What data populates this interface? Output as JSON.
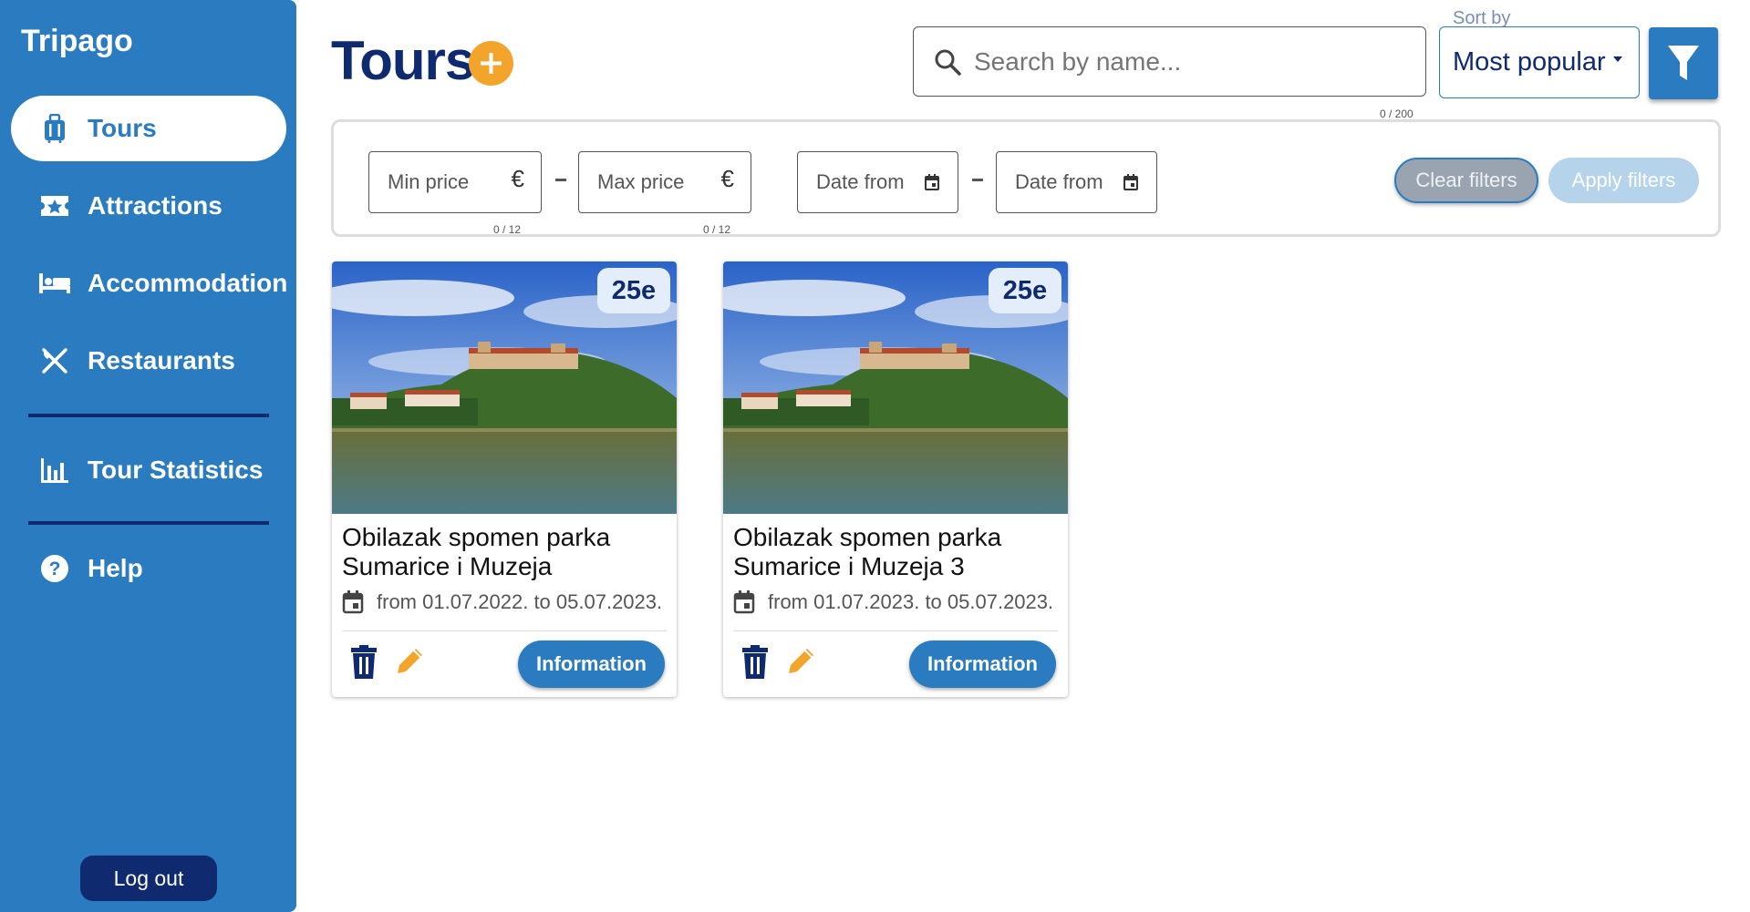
{
  "app": {
    "brand": "Tripago"
  },
  "sidebar": {
    "items": [
      {
        "label": "Tours",
        "icon": "suitcase-icon",
        "active": true
      },
      {
        "label": "Attractions",
        "icon": "ticket-star-icon",
        "active": false
      },
      {
        "label": "Accommodation",
        "icon": "bed-icon",
        "active": false
      },
      {
        "label": "Restaurants",
        "icon": "fork-knife-icon",
        "active": false
      },
      {
        "label": "Tour Statistics",
        "icon": "bar-chart-icon",
        "active": false
      },
      {
        "label": "Help",
        "icon": "help-icon",
        "active": false
      }
    ],
    "logout_label": "Log out"
  },
  "header": {
    "title": "Tours"
  },
  "search": {
    "placeholder": "Search by name...",
    "counter": "0 / 200"
  },
  "sort": {
    "label": "Sort by",
    "value": "Most popular"
  },
  "filters": {
    "min_price": {
      "placeholder": "Min price",
      "suffix": "€",
      "counter": "0 / 12"
    },
    "max_price": {
      "placeholder": "Max price",
      "suffix": "€",
      "counter": "0 / 12"
    },
    "date_from_1": {
      "placeholder": "Date from"
    },
    "date_from_2": {
      "placeholder": "Date from"
    },
    "clear_label": "Clear filters",
    "apply_label": "Apply filters"
  },
  "tours": [
    {
      "price": "25e",
      "title": "Obilazak spomen parka Sumarice i Muzeja",
      "dates": "from 01.07.2022. to 05.07.2023.",
      "info_label": "Information"
    },
    {
      "price": "25e",
      "title": "Obilazak spomen parka Sumarice i Muzeja 3",
      "dates": "from 01.07.2023. to 05.07.2023.",
      "info_label": "Information"
    }
  ],
  "colors": {
    "primary": "#2a7bbf",
    "navy": "#0f2a6e",
    "accent": "#f3a52b"
  }
}
